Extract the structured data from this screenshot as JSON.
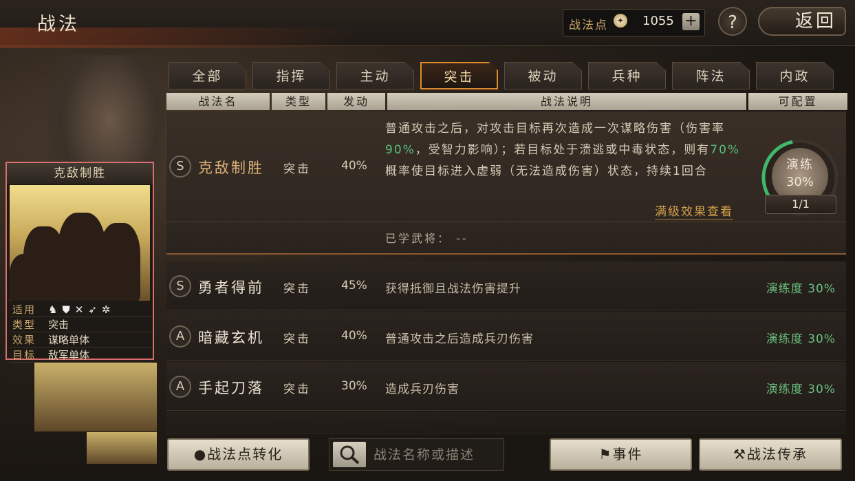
{
  "header": {
    "title": "战法",
    "points_label": "战法点",
    "points_value": "1055",
    "plus_label": "+",
    "help_label": "?",
    "back_label": "返回"
  },
  "card": {
    "name": "克敌制胜",
    "attrs": [
      {
        "key": "适用",
        "value": ""
      },
      {
        "key": "类型",
        "value": "突击"
      },
      {
        "key": "效果",
        "value": "谋略单体"
      },
      {
        "key": "目标",
        "value": "敌军单体"
      }
    ]
  },
  "tabs": [
    "全部",
    "指挥",
    "主动",
    "突击",
    "被动",
    "兵种",
    "阵法",
    "内政"
  ],
  "active_tab": "突击",
  "columns": [
    "战法名",
    "类型",
    "发动",
    "战法说明",
    "可配置"
  ],
  "expanded": {
    "grade": "S",
    "name": "克敌制胜",
    "type": "突击",
    "rate": "40%",
    "desc_parts": {
      "p1": "普通攻击之后，对攻击目标再次造成一次谋略伤害（伤害率",
      "h1": "90%",
      "p2": "，受智力影响）；若目标处于溃逃或中毒状态，则有",
      "h2": "70%",
      "p3": "概率使目标进入虚弱（无法造成伤害）状态，持续1回合"
    },
    "full_effect_link": "满级效果查看",
    "learned_label": "已学武将：",
    "learned_value": "--",
    "drill_label": "演练",
    "drill_value": "30%",
    "drill_fraction": 0.3,
    "slot_label": "1/1"
  },
  "rows": [
    {
      "grade": "S",
      "name": "勇者得前",
      "type": "突击",
      "rate": "45%",
      "desc": "获得抵御且战法伤害提升",
      "drill": "演练度 30%"
    },
    {
      "grade": "A",
      "name": "暗藏玄机",
      "type": "突击",
      "rate": "40%",
      "desc": "普通攻击之后造成兵刃伤害",
      "drill": "演练度 30%"
    },
    {
      "grade": "A",
      "name": "手起刀落",
      "type": "突击",
      "rate": "30%",
      "desc": "造成兵刃伤害",
      "drill": "演练度 30%"
    }
  ],
  "bottom": {
    "convert_label": "战法点转化",
    "search_placeholder": "战法名称或描述",
    "event_label": "事件",
    "inherit_label": "战法传承"
  },
  "colors": {
    "accent": "#e0892c",
    "highlight_green": "#58c07a",
    "card_border": "#d86f6f"
  }
}
